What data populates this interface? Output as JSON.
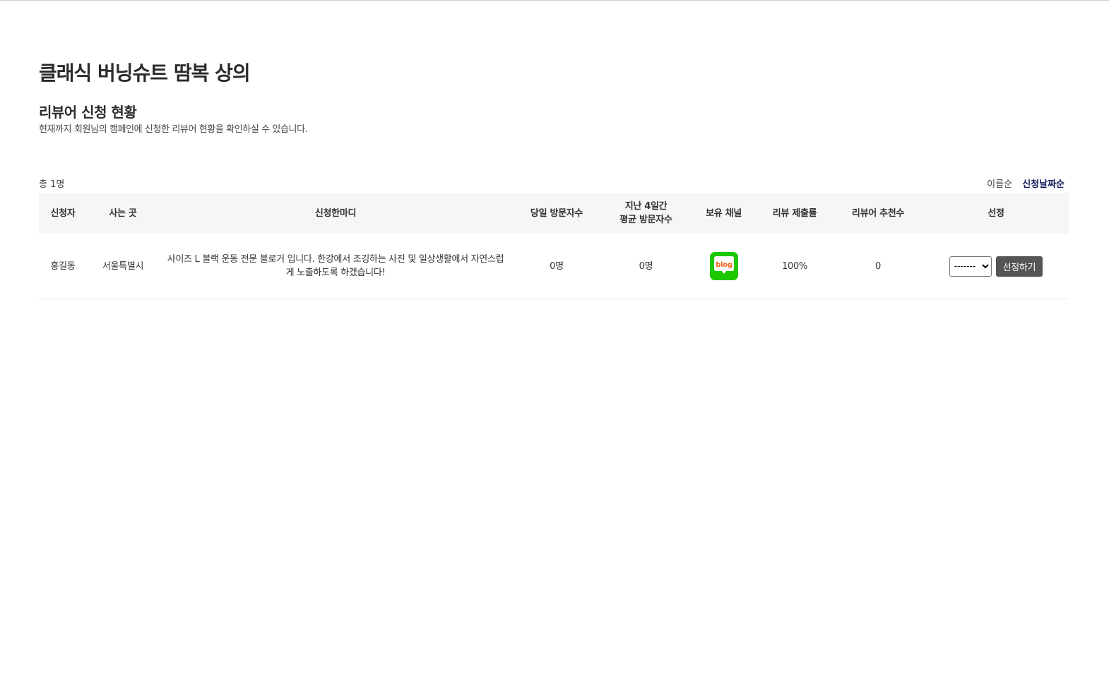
{
  "campaign": {
    "title": "클래식 버닝슈트 땀복 상의"
  },
  "section": {
    "title": "리뷰어 신청 현황",
    "description": "현재까지 회원님의 캠페인에 신청한 리뷰어 현황을 확인하실 수 있습니다."
  },
  "summary": {
    "total": "총 1명"
  },
  "sort": {
    "options": [
      {
        "label": "이름순",
        "active": false
      },
      {
        "label": "신청날짜순",
        "active": true
      }
    ]
  },
  "table": {
    "headers": {
      "applicant": "신청자",
      "location": "사는 곳",
      "comment": "신청한마디",
      "today_visitors": "당일 방문자수",
      "avg_visitors_line1": "지난 4일간",
      "avg_visitors_line2": "평균 방문자수",
      "channel": "보유 채널",
      "review_rate": "리뷰 제출률",
      "recommend": "리뷰어 추천수",
      "select": "선정"
    },
    "rows": [
      {
        "applicant": "홍길동",
        "location": "서울특별시",
        "comment": "사이즈 L 블랙 운동 전문 블로거 입니다. 한강에서 조깅하는 사진 및 일상생활에서 자연스럽게 노출하도록 하겠습니다!",
        "today_visitors": "0명",
        "avg_visitors": "0명",
        "channel_icon": "naver-blog-icon",
        "channel_icon_text": "blog",
        "channel_color": "#1ec800",
        "review_rate": "100%",
        "recommend": "0",
        "select_value": "-------",
        "select_button": "선정하기"
      }
    ]
  }
}
